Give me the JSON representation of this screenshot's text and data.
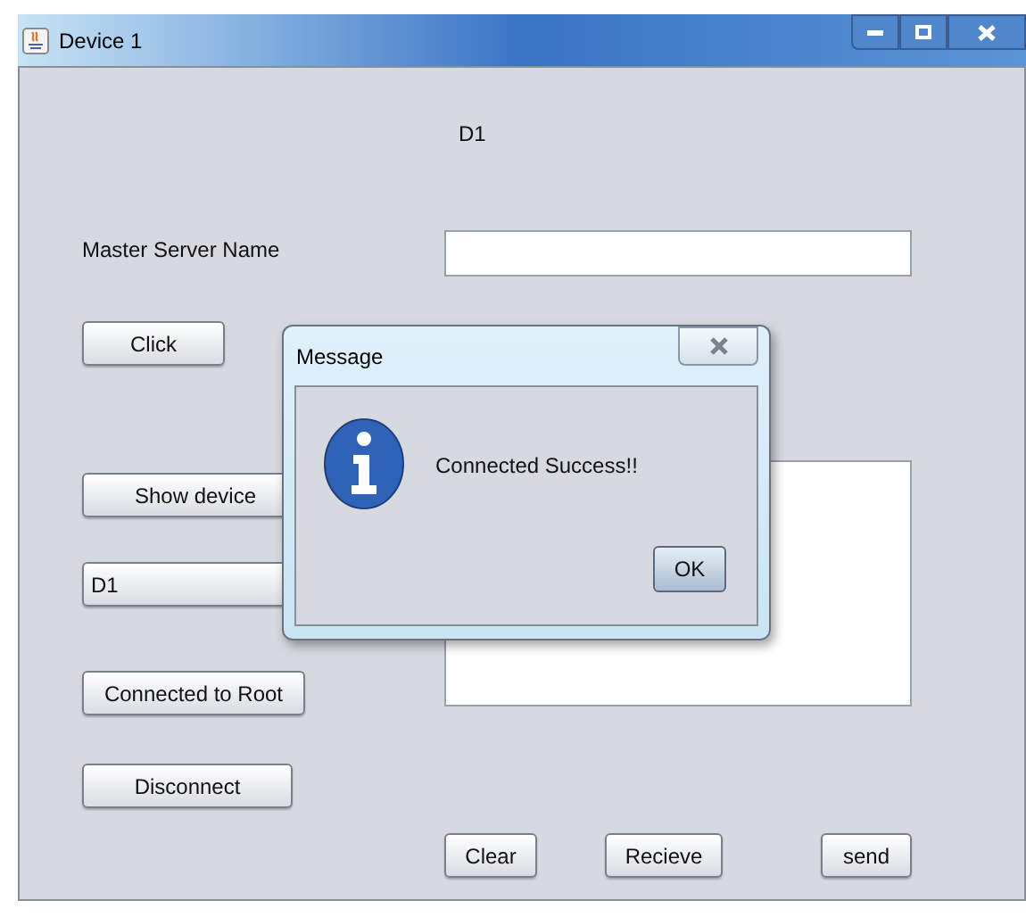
{
  "window": {
    "title": "Device 1"
  },
  "header_label": "D1",
  "master_server": {
    "label": "Master Server Name"
  },
  "buttons": {
    "click": "Click",
    "show_device": "Show device",
    "connect_root": "Connected to Root",
    "disconnect": "Disconnect",
    "clear": "Clear",
    "receive": "Recieve",
    "send": "send"
  },
  "device_combo": {
    "value": "D1"
  },
  "dialog": {
    "title": "Message",
    "message": "Connected Success!!",
    "ok": "OK"
  }
}
